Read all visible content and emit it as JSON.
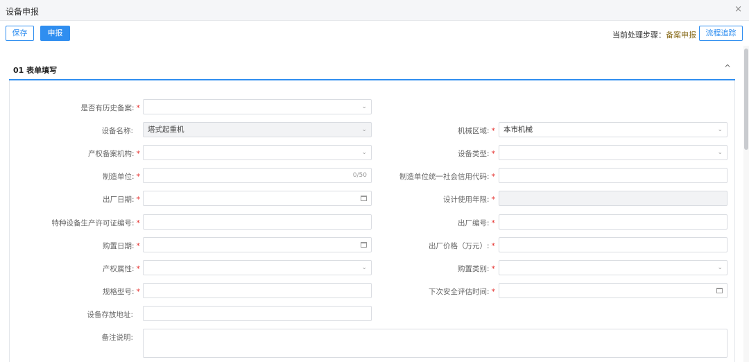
{
  "window": {
    "title": "设备申报",
    "close_glyph": "×"
  },
  "toolbar": {
    "save_label": "保存",
    "submit_label": "申报",
    "step_label": "当前处理步骤：",
    "step_value": "备案申报",
    "trace_label": "流程追踪"
  },
  "section": {
    "title": "01   表单填写",
    "collapse_glyph": "^"
  },
  "icons": {
    "chevron": "chevron-down-icon",
    "calendar": "calendar-icon",
    "collapse": "chevron-up-icon"
  },
  "colors": {
    "accent": "#2f8ef0",
    "required": "#e5302d",
    "step_value": "#8a6d1e"
  },
  "form": {
    "history_record": {
      "label": "是否有历史备案:",
      "value": ""
    },
    "device_name": {
      "label": "设备名称:",
      "value": "塔式起重机"
    },
    "machine_region": {
      "label": "机械区域:",
      "value": "本市机械"
    },
    "property_org": {
      "label": "产权备案机构:",
      "value": ""
    },
    "device_type": {
      "label": "设备类型:",
      "value": ""
    },
    "manufacturer": {
      "label": "制造单位:",
      "value": "",
      "counter": "0/50"
    },
    "credit_code": {
      "label": "制造单位统一社会信用代码:",
      "value": ""
    },
    "factory_date": {
      "label": "出厂日期:",
      "value": ""
    },
    "design_life": {
      "label": "设计使用年限:",
      "value": ""
    },
    "license_no": {
      "label": "特种设备生产许可证编号:",
      "value": ""
    },
    "factory_no": {
      "label": "出厂编号:",
      "value": ""
    },
    "purchase_date": {
      "label": "购置日期:",
      "value": ""
    },
    "factory_price": {
      "label": "出厂价格（万元）:",
      "value": ""
    },
    "property_attr": {
      "label": "产权属性:",
      "value": ""
    },
    "purchase_type": {
      "label": "购置类别:",
      "value": ""
    },
    "spec_model": {
      "label": "规格型号:",
      "value": ""
    },
    "next_eval_time": {
      "label": "下次安全评估时间:",
      "value": ""
    },
    "storage_address": {
      "label": "设备存放地址:",
      "value": ""
    },
    "remark": {
      "label": "备注说明:",
      "value": ""
    },
    "required_mark": "*"
  }
}
